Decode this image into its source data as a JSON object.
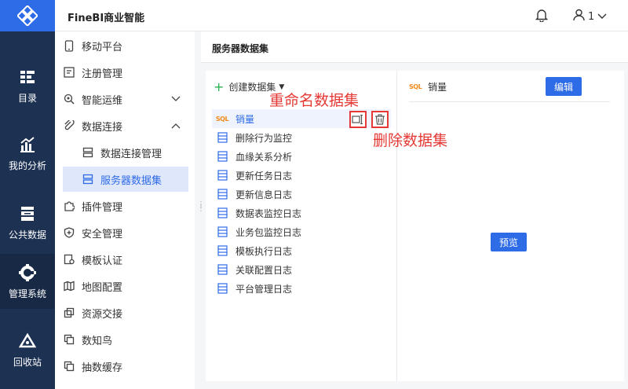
{
  "topbar": {
    "title": "FineBI商业智能",
    "user_label": "1"
  },
  "leftnav": [
    {
      "label": "目录",
      "icon": "catalog-icon"
    },
    {
      "label": "我的分析",
      "icon": "analysis-icon"
    },
    {
      "label": "公共数据",
      "icon": "public-data-icon"
    },
    {
      "label": "管理系统",
      "icon": "gear-icon",
      "active": true
    },
    {
      "label": "回收站",
      "icon": "recycle-icon"
    }
  ],
  "submenu": [
    {
      "label": "移动平台",
      "icon": "mobile-icon"
    },
    {
      "label": "注册管理",
      "icon": "register-icon"
    },
    {
      "label": "智能运维",
      "icon": "ops-icon",
      "chevron": "down"
    },
    {
      "label": "数据连接",
      "icon": "link-icon",
      "chevron": "up"
    },
    {
      "label": "数据连接管理",
      "icon": "db-icon",
      "sub": true
    },
    {
      "label": "服务器数据集",
      "icon": "dataset-icon",
      "sub": true,
      "selected": true
    },
    {
      "label": "插件管理",
      "icon": "plugin-icon"
    },
    {
      "label": "安全管理",
      "icon": "shield-icon"
    },
    {
      "label": "模板认证",
      "icon": "template-icon"
    },
    {
      "label": "地图配置",
      "icon": "map-icon"
    },
    {
      "label": "资源交接",
      "icon": "handover-icon"
    },
    {
      "label": "数知鸟",
      "icon": "bird-icon"
    },
    {
      "label": "抽数缓存",
      "icon": "cache-icon"
    }
  ],
  "main": {
    "page_title": "服务器数据集",
    "create_label": "创建数据集",
    "datasets": [
      {
        "label": "销量",
        "type": "sql",
        "selected": true
      },
      {
        "label": "删除行为监控",
        "type": "table"
      },
      {
        "label": "血缘关系分析",
        "type": "table"
      },
      {
        "label": "更新任务日志",
        "type": "table"
      },
      {
        "label": "更新信息日志",
        "type": "table"
      },
      {
        "label": "数据表监控日志",
        "type": "table"
      },
      {
        "label": "业务包监控日志",
        "type": "table"
      },
      {
        "label": "模板执行日志",
        "type": "table"
      },
      {
        "label": "关联配置日志",
        "type": "table"
      },
      {
        "label": "平台管理日志",
        "type": "table"
      }
    ],
    "sql_tag": "SQL",
    "annotations": {
      "rename": "重命名数据集",
      "delete": "删除数据集"
    },
    "detail": {
      "title": "销量",
      "edit_label": "编辑",
      "preview_label": "预览"
    }
  },
  "colors": {
    "accent": "#2e6be6",
    "nav_bg": "#1d3152",
    "annotation": "#e53935",
    "sql": "#f28b1e"
  }
}
